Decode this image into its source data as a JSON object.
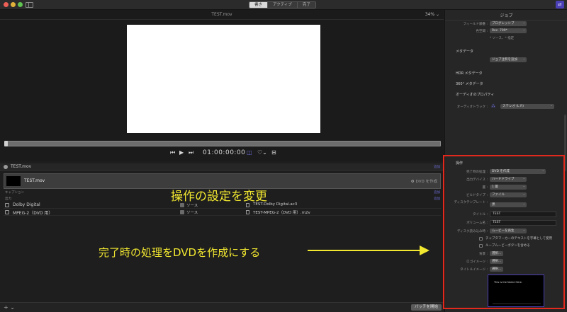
{
  "titlebar": {
    "tabs": [
      "書き",
      "アクティブ",
      "完了"
    ]
  },
  "viewer": {
    "title": "TEST.mov",
    "zoom": "34% ⌄",
    "timecode": "01:00:00:00"
  },
  "batch": {
    "name": "TEST.mov",
    "tag": "追加",
    "job": {
      "name": "TEST.mov",
      "action": "DVD を作成"
    },
    "sections": {
      "caption": "キャプション",
      "caption_tag": "追加",
      "output": "出力",
      "output_tag": "追加"
    },
    "outputs": [
      {
        "label": "Dolby Digital",
        "source": "ソース",
        "file": "TEST-Dolby Digital.ac3"
      },
      {
        "label": "MPEG-2（DVD 用）",
        "source": "ソース",
        "file": "TEST-MPEG-2（DVD 用）.m2v"
      }
    ],
    "start_button": "バッチを開始",
    "add_button": "+ ⌄"
  },
  "annotations": {
    "top": "操作の設定を変更",
    "bottom": "完了時の処理をDVDを作成にする"
  },
  "inspector": {
    "title": "ジョブ",
    "field_order_label": "フィールド順番 :",
    "field_order_value": "プログレッシブ",
    "color_space_label": "色空間 :",
    "color_space_value": "Rec. 709*",
    "color_note": "* ソース、* 指定",
    "metadata_heading": "メタデータ",
    "metadata_button": "ジョブ注釈を追加",
    "hdr_heading": "HDR メタデータ",
    "vr_heading": "360° メタデータ",
    "audio_heading": "オーディオのプロパティ",
    "audio_track_label": "オーディオトラック :",
    "audio_track_value": "ステレオ (L R)",
    "operation_heading": "操作",
    "after_done_label": "完了時の処理 :",
    "after_done_value": "DVD を作成",
    "output_device_label": "出力デバイス :",
    "output_device_value": "ハードドライブ",
    "layers_label": "層 :",
    "layers_value": "1 層",
    "build_type_label": "ビルドタイプ :",
    "build_type_value": "ファイル",
    "template_label": "ディスクテンプレート :",
    "template_value": "黒",
    "title_label": "タイトル :",
    "title_value": "TEST",
    "volume_label": "ボリューム名 :",
    "volume_value": "TEST",
    "disc_load_label": "ディスク読み込み時 :",
    "disc_load_value": "ムービーを再生",
    "chk1": "チャプタマーカーのテキストを字幕として使用",
    "chk2": "ループムービーボタンを含める",
    "bg_label": "背景 :",
    "logo_label": "ロゴイメージ :",
    "title_img_label": "タイトルイメージ :",
    "choose": "選択...",
    "preview_text": "This is the Name Here."
  }
}
